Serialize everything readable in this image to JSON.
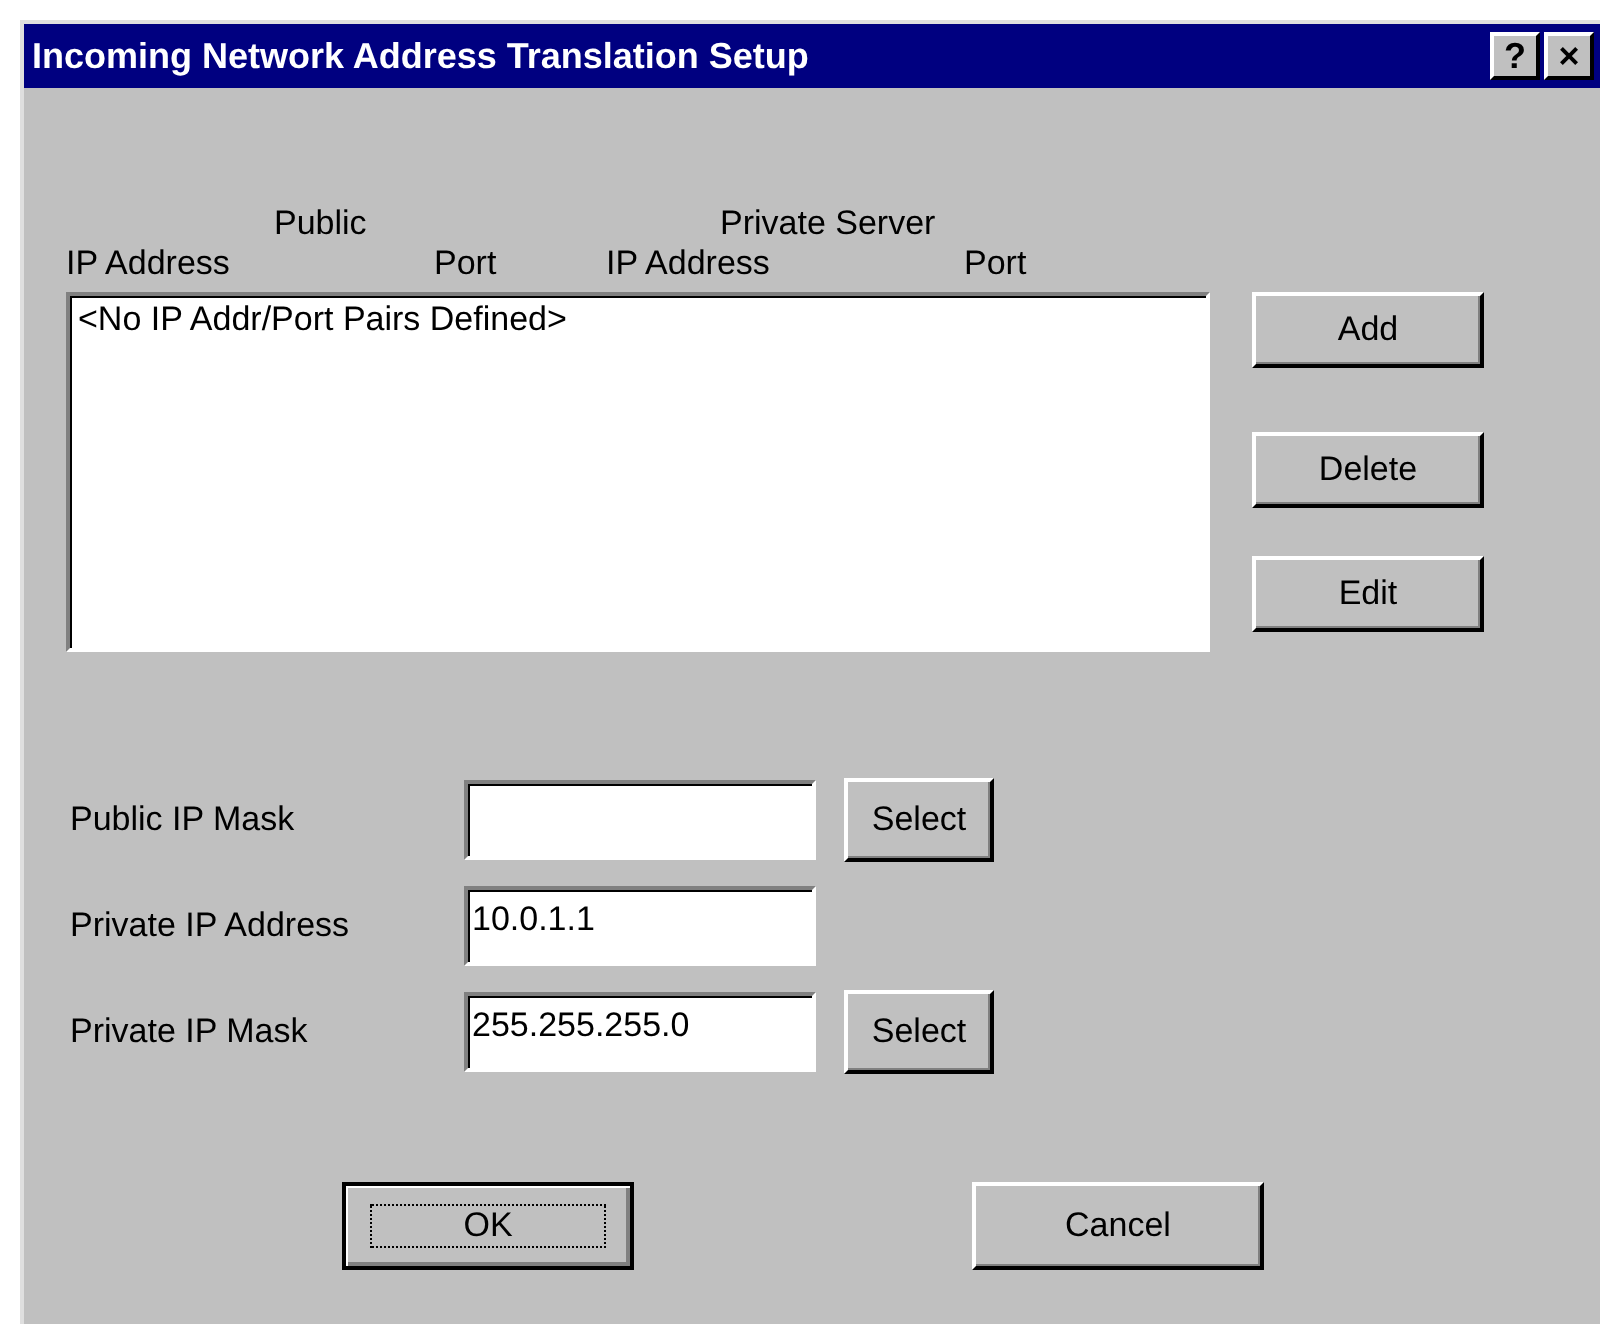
{
  "window": {
    "title": "Incoming Network Address Translation Setup",
    "title_buttons": [
      "?",
      "×"
    ]
  },
  "columns": [
    {
      "group": "Public",
      "label": "IP Address"
    },
    {
      "label": "Port"
    },
    {
      "group": "Private Server",
      "label": "IP Address"
    },
    {
      "label": "Port"
    }
  ],
  "list": {
    "items": [
      "<No IP Addr/Port Pairs Defined>"
    ]
  },
  "list_buttons": [
    "Add",
    "Delete",
    "Edit"
  ],
  "fields": [
    {
      "label": "Public IP Mask",
      "button": "Select"
    },
    {
      "label": "Private IP Address",
      "value": "10.0.1.1"
    },
    {
      "label": "Private IP Mask",
      "value": "255.255.255.0",
      "button": "Select"
    }
  ],
  "buttons": [
    {
      "label": "OK",
      "default": true
    },
    {
      "label": "Cancel",
      "default": false
    }
  ]
}
